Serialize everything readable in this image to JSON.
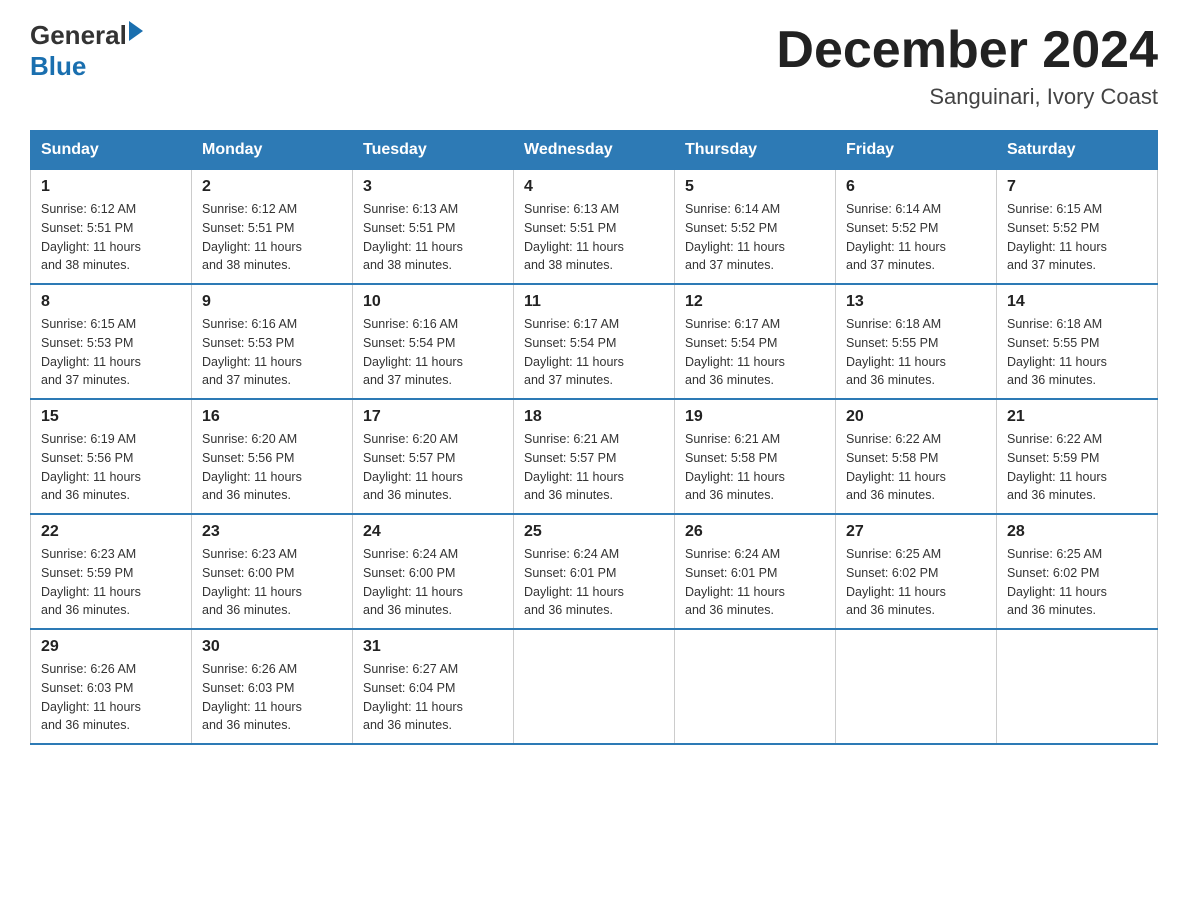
{
  "logo": {
    "general": "General",
    "blue": "Blue"
  },
  "title": {
    "month_year": "December 2024",
    "location": "Sanguinari, Ivory Coast"
  },
  "headers": [
    "Sunday",
    "Monday",
    "Tuesday",
    "Wednesday",
    "Thursday",
    "Friday",
    "Saturday"
  ],
  "weeks": [
    [
      {
        "day": "1",
        "sunrise": "6:12 AM",
        "sunset": "5:51 PM",
        "daylight": "11 hours and 38 minutes."
      },
      {
        "day": "2",
        "sunrise": "6:12 AM",
        "sunset": "5:51 PM",
        "daylight": "11 hours and 38 minutes."
      },
      {
        "day": "3",
        "sunrise": "6:13 AM",
        "sunset": "5:51 PM",
        "daylight": "11 hours and 38 minutes."
      },
      {
        "day": "4",
        "sunrise": "6:13 AM",
        "sunset": "5:51 PM",
        "daylight": "11 hours and 38 minutes."
      },
      {
        "day": "5",
        "sunrise": "6:14 AM",
        "sunset": "5:52 PM",
        "daylight": "11 hours and 37 minutes."
      },
      {
        "day": "6",
        "sunrise": "6:14 AM",
        "sunset": "5:52 PM",
        "daylight": "11 hours and 37 minutes."
      },
      {
        "day": "7",
        "sunrise": "6:15 AM",
        "sunset": "5:52 PM",
        "daylight": "11 hours and 37 minutes."
      }
    ],
    [
      {
        "day": "8",
        "sunrise": "6:15 AM",
        "sunset": "5:53 PM",
        "daylight": "11 hours and 37 minutes."
      },
      {
        "day": "9",
        "sunrise": "6:16 AM",
        "sunset": "5:53 PM",
        "daylight": "11 hours and 37 minutes."
      },
      {
        "day": "10",
        "sunrise": "6:16 AM",
        "sunset": "5:54 PM",
        "daylight": "11 hours and 37 minutes."
      },
      {
        "day": "11",
        "sunrise": "6:17 AM",
        "sunset": "5:54 PM",
        "daylight": "11 hours and 37 minutes."
      },
      {
        "day": "12",
        "sunrise": "6:17 AM",
        "sunset": "5:54 PM",
        "daylight": "11 hours and 36 minutes."
      },
      {
        "day": "13",
        "sunrise": "6:18 AM",
        "sunset": "5:55 PM",
        "daylight": "11 hours and 36 minutes."
      },
      {
        "day": "14",
        "sunrise": "6:18 AM",
        "sunset": "5:55 PM",
        "daylight": "11 hours and 36 minutes."
      }
    ],
    [
      {
        "day": "15",
        "sunrise": "6:19 AM",
        "sunset": "5:56 PM",
        "daylight": "11 hours and 36 minutes."
      },
      {
        "day": "16",
        "sunrise": "6:20 AM",
        "sunset": "5:56 PM",
        "daylight": "11 hours and 36 minutes."
      },
      {
        "day": "17",
        "sunrise": "6:20 AM",
        "sunset": "5:57 PM",
        "daylight": "11 hours and 36 minutes."
      },
      {
        "day": "18",
        "sunrise": "6:21 AM",
        "sunset": "5:57 PM",
        "daylight": "11 hours and 36 minutes."
      },
      {
        "day": "19",
        "sunrise": "6:21 AM",
        "sunset": "5:58 PM",
        "daylight": "11 hours and 36 minutes."
      },
      {
        "day": "20",
        "sunrise": "6:22 AM",
        "sunset": "5:58 PM",
        "daylight": "11 hours and 36 minutes."
      },
      {
        "day": "21",
        "sunrise": "6:22 AM",
        "sunset": "5:59 PM",
        "daylight": "11 hours and 36 minutes."
      }
    ],
    [
      {
        "day": "22",
        "sunrise": "6:23 AM",
        "sunset": "5:59 PM",
        "daylight": "11 hours and 36 minutes."
      },
      {
        "day": "23",
        "sunrise": "6:23 AM",
        "sunset": "6:00 PM",
        "daylight": "11 hours and 36 minutes."
      },
      {
        "day": "24",
        "sunrise": "6:24 AM",
        "sunset": "6:00 PM",
        "daylight": "11 hours and 36 minutes."
      },
      {
        "day": "25",
        "sunrise": "6:24 AM",
        "sunset": "6:01 PM",
        "daylight": "11 hours and 36 minutes."
      },
      {
        "day": "26",
        "sunrise": "6:24 AM",
        "sunset": "6:01 PM",
        "daylight": "11 hours and 36 minutes."
      },
      {
        "day": "27",
        "sunrise": "6:25 AM",
        "sunset": "6:02 PM",
        "daylight": "11 hours and 36 minutes."
      },
      {
        "day": "28",
        "sunrise": "6:25 AM",
        "sunset": "6:02 PM",
        "daylight": "11 hours and 36 minutes."
      }
    ],
    [
      {
        "day": "29",
        "sunrise": "6:26 AM",
        "sunset": "6:03 PM",
        "daylight": "11 hours and 36 minutes."
      },
      {
        "day": "30",
        "sunrise": "6:26 AM",
        "sunset": "6:03 PM",
        "daylight": "11 hours and 36 minutes."
      },
      {
        "day": "31",
        "sunrise": "6:27 AM",
        "sunset": "6:04 PM",
        "daylight": "11 hours and 36 minutes."
      },
      null,
      null,
      null,
      null
    ]
  ],
  "labels": {
    "sunrise": "Sunrise:",
    "sunset": "Sunset:",
    "daylight": "Daylight:"
  }
}
